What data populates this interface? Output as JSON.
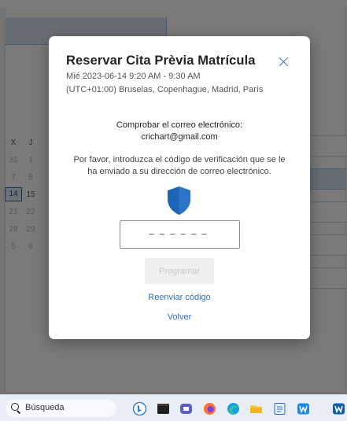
{
  "dialog": {
    "title": "Reservar Cita Prèvia Matrícula",
    "datetime": "Mié 2023-06-14 9:20 AM - 9:30 AM",
    "timezone": "(UTC+01:00) Bruselas, Copenhague, Madrid, París",
    "verify_heading": "Comprobar el correo electrónico:",
    "email": "crichart@gmail.com",
    "verify_message": "Por favor, introduzca el código de verificación que se le ha enviado a su dirección de correo electrónico.",
    "code_placeholder": "––––––",
    "program_button": "Programar",
    "resend_link": "Reenviar código",
    "back_link": "Volver"
  },
  "background_calendar": {
    "weekday_headers": [
      "X",
      "J"
    ],
    "rows": [
      [
        "31",
        "1"
      ],
      [
        "7",
        "8"
      ],
      [
        "14",
        "15"
      ],
      [
        "21",
        "22"
      ],
      [
        "28",
        "29"
      ],
      [
        "5",
        "6"
      ]
    ],
    "selected_day": "14"
  },
  "taskbar": {
    "search_label": "Búsqueda",
    "icons": [
      "bing-icon",
      "terminal-icon",
      "teams-icon",
      "firefox-icon",
      "edge-icon",
      "file-explorer-icon",
      "notepad-icon",
      "app-icon"
    ]
  },
  "colors": {
    "accent": "#2f6fbf",
    "shield": "#1f64b6"
  }
}
